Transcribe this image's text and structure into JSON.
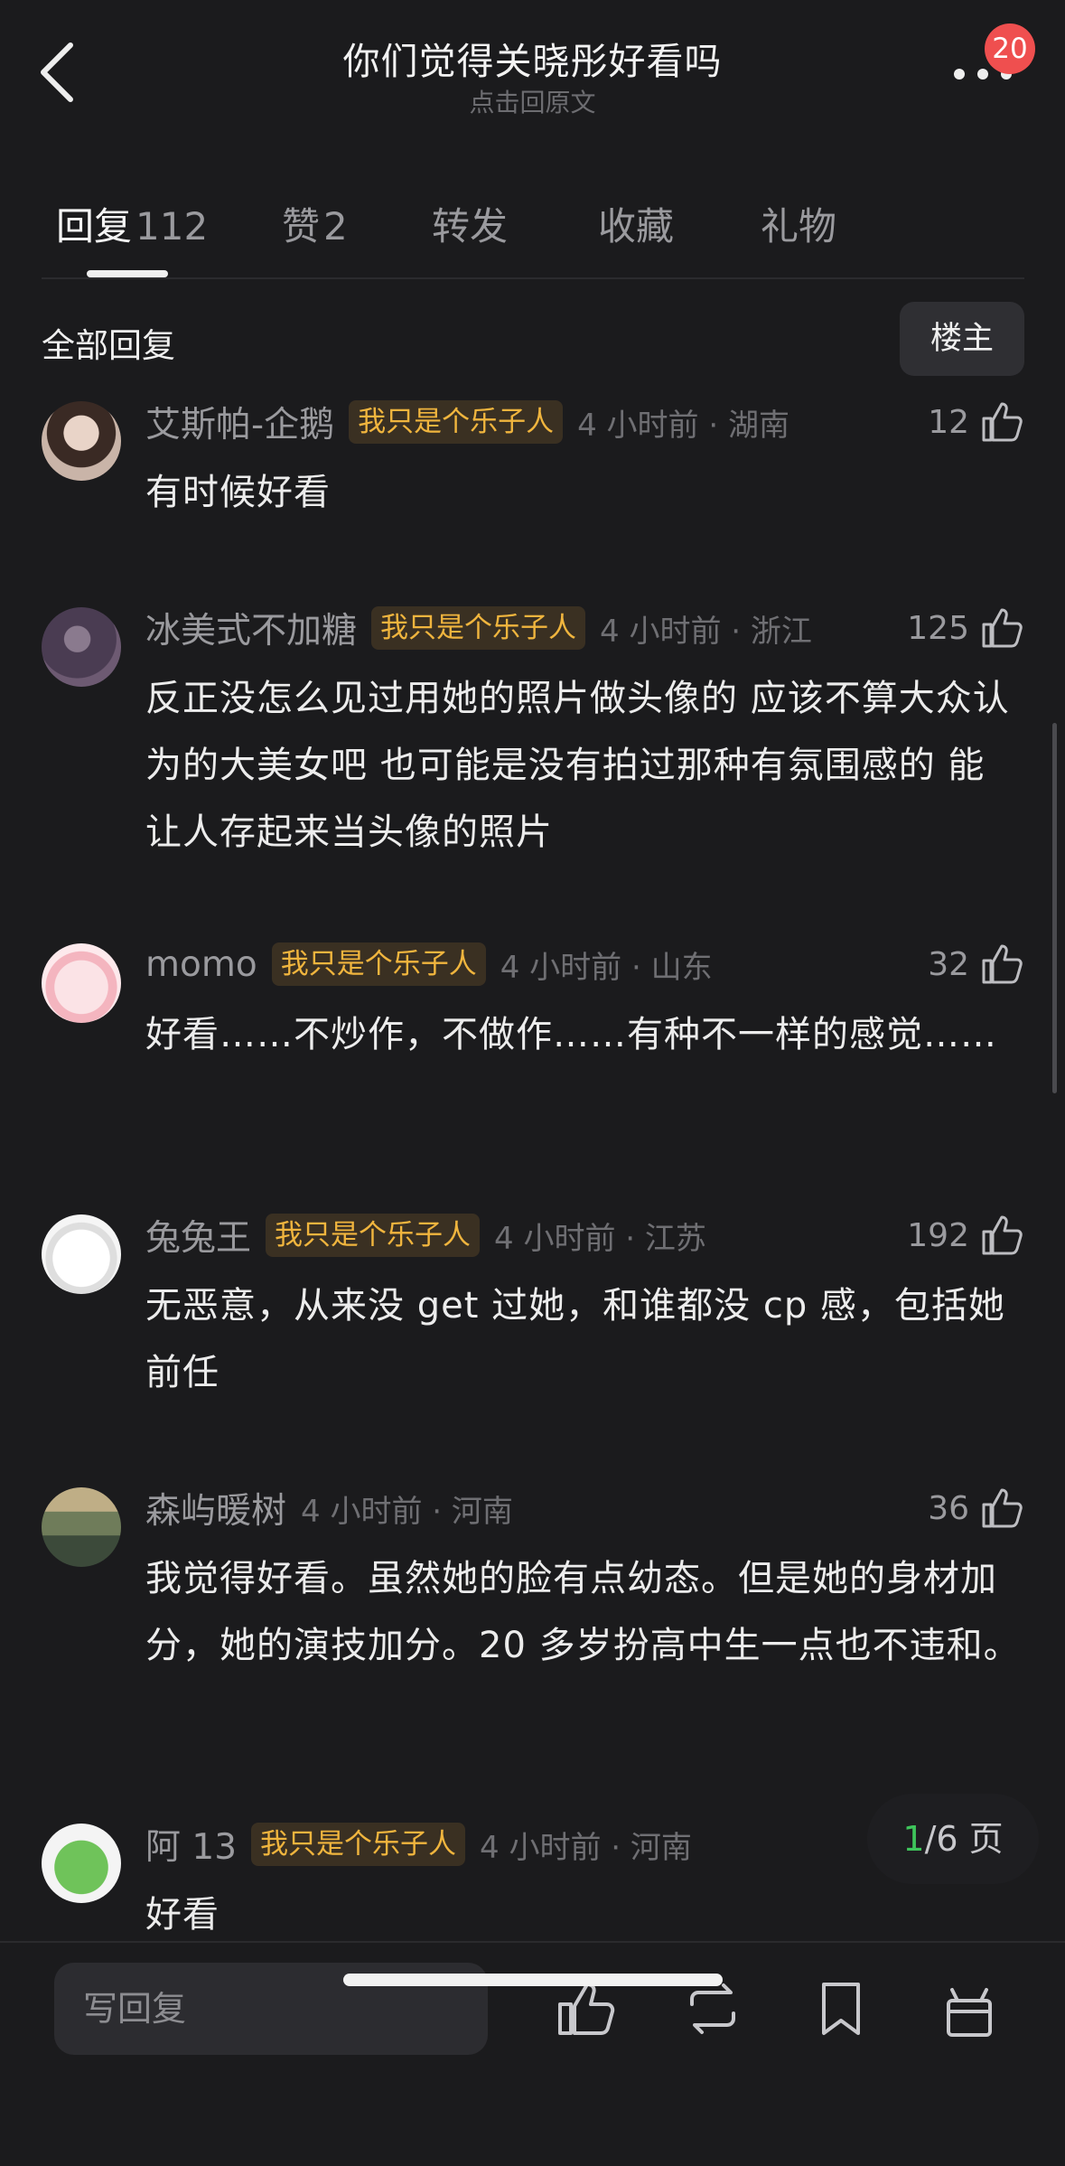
{
  "header": {
    "title": "你们觉得关晓彤好看吗",
    "subtitle": "点击回原文",
    "badge": "20"
  },
  "tabs": [
    {
      "label": "回复",
      "count": "112"
    },
    {
      "label": "赞",
      "count": "2"
    },
    {
      "label": "转发",
      "count": ""
    },
    {
      "label": "收藏",
      "count": ""
    },
    {
      "label": "礼物",
      "count": ""
    }
  ],
  "section": {
    "title": "全部回复",
    "filter": "楼主"
  },
  "comments": [
    {
      "user": "艾斯帕-企鹅",
      "tag": "我只是个乐子人",
      "time": "4 小时前 · 湖南",
      "likes": "12",
      "content": "有时候好看"
    },
    {
      "user": "冰美式不加糖",
      "tag": "我只是个乐子人",
      "time": "4 小时前 · 浙江",
      "likes": "125",
      "content": "反正没怎么见过用她的照片做头像的 应该不算大众认为的大美女吧 也可能是没有拍过那种有氛围感的 能让人存起来当头像的照片"
    },
    {
      "user": "momo",
      "tag": "我只是个乐子人",
      "time": "4 小时前 · 山东",
      "likes": "32",
      "content": "好看……不炒作，不做作……有种不一样的感觉……"
    },
    {
      "user": "兔兔王",
      "tag": "我只是个乐子人",
      "time": "4 小时前 · 江苏",
      "likes": "192",
      "content": "无恶意，从来没 get 过她，和谁都没 cp 感，包括她前任"
    },
    {
      "user": "森屿暖树",
      "tag": "",
      "time": "4 小时前 · 河南",
      "likes": "36",
      "content": "我觉得好看。虽然她的脸有点幼态。但是她的身材加分，她的演技加分。20 多岁扮高中生一点也不违和。"
    },
    {
      "user": "阿 13",
      "tag": "我只是个乐子人",
      "time": "4 小时前 · 河南",
      "likes": "",
      "content": "好看"
    }
  ],
  "pager": {
    "current": "1",
    "total": "/6 页"
  },
  "bottom": {
    "reply_placeholder": "写回复",
    "icons": [
      "like-icon",
      "repost-icon",
      "bookmark-icon",
      "gift-icon"
    ]
  },
  "colors": {
    "background": "#1b1b1d",
    "tag_text": "#f0b53e",
    "badge": "#ef4f4f",
    "pager_current": "#3ec45b"
  }
}
